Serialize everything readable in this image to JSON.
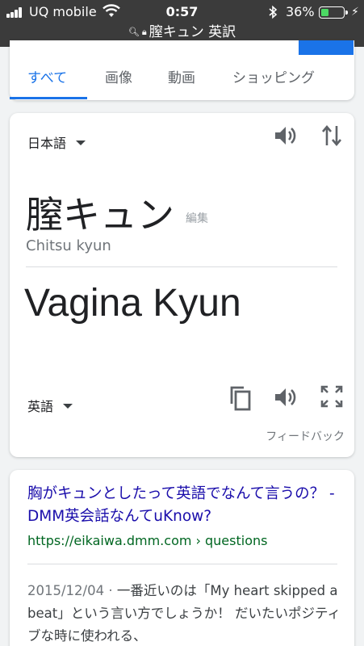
{
  "status_bar": {
    "carrier": "UQ mobile",
    "time": "0:57",
    "battery_percent": "36%",
    "battery_level": 0.36,
    "battery_color": "#4cd964",
    "icons": [
      "signal-icon",
      "wifi-icon",
      "bluetooth-icon",
      "battery-icon",
      "charging-icon"
    ]
  },
  "url_bar": {
    "text": "膣キュン 英訳",
    "icons": [
      "search-icon",
      "lock-icon"
    ]
  },
  "tabs": [
    {
      "label": "すべて",
      "active": true
    },
    {
      "label": "画像",
      "active": false
    },
    {
      "label": "動画",
      "active": false
    },
    {
      "label": "ショッピング",
      "active": false
    }
  ],
  "translate": {
    "source_lang": "日本語",
    "source_text": "膣キュン",
    "edit_label": "編集",
    "romanization": "Chitsu kyun",
    "translated_text": "Vagina Kyun",
    "target_lang": "英語",
    "feedback_label": "フィードバック",
    "icons": [
      "speaker-icon",
      "swap-icon",
      "copy-icon",
      "speaker-icon",
      "fullscreen-icon"
    ]
  },
  "result": {
    "title": "胸がキュンとしたって英語でなんて言うの？ - DMM英会話なんてuKnow?",
    "url": "https://eikaiwa.dmm.com › questions",
    "date": "2015/12/04",
    "snippet": "一番近いのは「My heart skipped a beat」という言い方でしょうか！ だいたいポジティブな時に使われる、"
  },
  "colors": {
    "accent": "#1a73e8",
    "link": "#1a0dab",
    "url_green": "#006621"
  }
}
